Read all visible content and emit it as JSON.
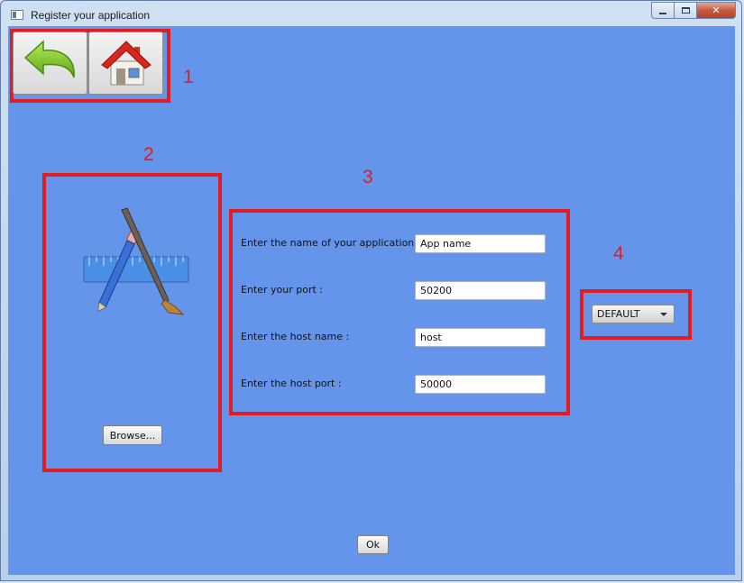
{
  "window": {
    "title": "Register your application",
    "icon": "app-window-icon",
    "controls": [
      "minimize-icon",
      "maximize-icon",
      "close-icon"
    ]
  },
  "nav": {
    "back_icon": "back-arrow-icon",
    "home_icon": "home-icon"
  },
  "image_panel": {
    "icon": "app-design-pencil-brush-ruler-icon",
    "browse_label": "Browse..."
  },
  "form": {
    "fields": [
      {
        "label": "Enter the name of your application :",
        "value": "App name"
      },
      {
        "label": "Enter your port :",
        "value": "50200"
      },
      {
        "label": "Enter the host name :",
        "value": "host"
      },
      {
        "label": "Enter the host port :",
        "value": "50000"
      }
    ]
  },
  "theme_select": {
    "selected": "DEFAULT"
  },
  "ok_label": "Ok",
  "annotations": {
    "n1": "1",
    "n2": "2",
    "n3": "3",
    "n4": "4"
  },
  "colors": {
    "client_background": "#6495ea",
    "annotation_red": "#e21c23"
  }
}
